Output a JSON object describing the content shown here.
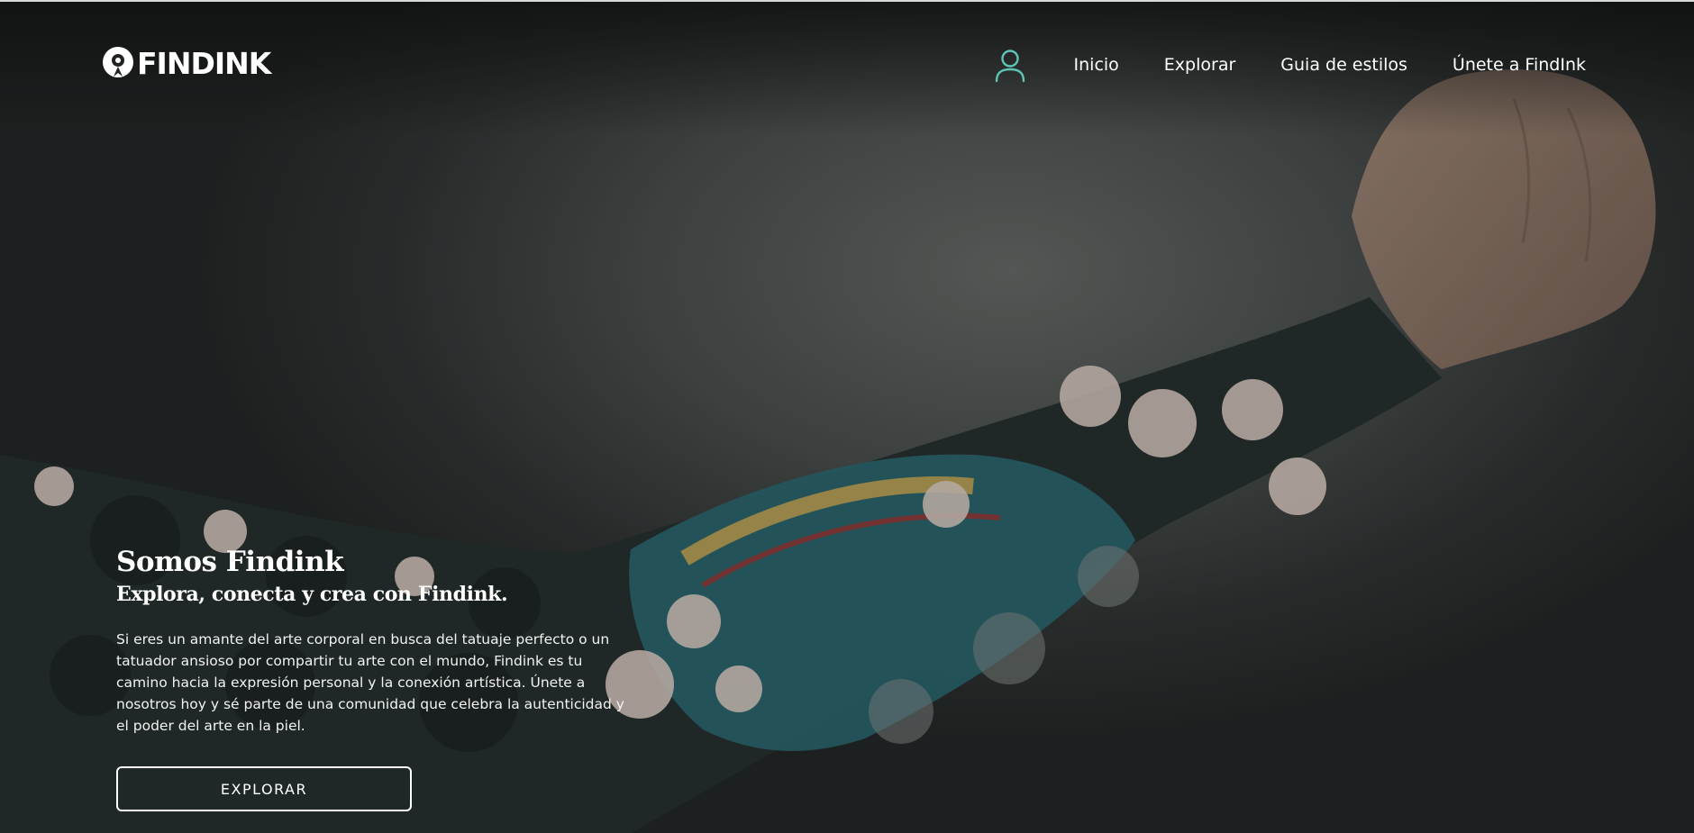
{
  "brand": {
    "logo_text": "FINDINK",
    "logo_icon": "pin-vinyl-icon"
  },
  "nav": {
    "user_icon": "user-icon",
    "items": [
      {
        "label": "Inicio"
      },
      {
        "label": "Explorar"
      },
      {
        "label": "Guia de estilos"
      },
      {
        "label": "Únete a FindInk"
      }
    ]
  },
  "hero": {
    "title": "Somos Findink",
    "subtitle": "Explora, conecta y crea con Findink.",
    "description": "Si eres un amante del arte corporal en busca del tatuaje perfecto o un tatuador ansioso por compartir tu arte con el mundo, Findink es tu camino hacia la expresión personal y la conexión artística. Únete a nosotros hoy y sé parte de una comunidad que celebra la autenticidad y el poder del arte en la piel.",
    "cta_label": "EXPLORAR",
    "background_image": "tattooed-arm-photo"
  },
  "colors": {
    "accent": "#5ec4b6",
    "text": "#ffffff",
    "background": "#3f4341"
  }
}
